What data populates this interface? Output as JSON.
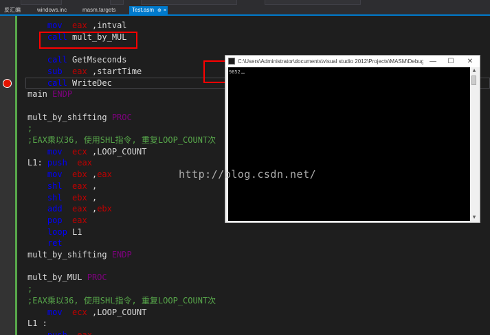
{
  "tabs": [
    {
      "label": "反汇编",
      "active": false
    },
    {
      "label": "windows.inc",
      "active": false
    },
    {
      "label": "masm.targets",
      "active": false
    },
    {
      "label": "Test.asm",
      "active": true,
      "pin_icon": "pin-icon",
      "close_icon": "close-icon"
    }
  ],
  "toolbar": {
    "label_left": "",
    "label_mid": ""
  },
  "code": [
    {
      "indent": "    ",
      "op": "mov",
      "a1": "eax",
      "sep": " ,",
      "rest": "intval"
    },
    {
      "indent": "    ",
      "op": "call",
      "rest": " mult_by_MUL"
    },
    {
      "indent": "",
      "op": "",
      "rest": ""
    },
    {
      "indent": "    ",
      "op": "call",
      "rest": " GetMseconds"
    },
    {
      "indent": "    ",
      "op": "sub",
      "a1": "eax",
      "sep": " ,",
      "rest": "startTime"
    },
    {
      "indent": "    ",
      "op": "call",
      "rest": " WriteDec"
    },
    {
      "text": "main",
      "dir": "ENDP"
    },
    {
      "text": ""
    },
    {
      "text": "mult_by_shifting",
      "dir": "PROC"
    },
    {
      "comment": ";"
    },
    {
      "comment": ";EAX乘以36, 使用SHL指令, 重复LOOP_COUNT次"
    },
    {
      "indent": "    ",
      "op": "mov",
      "a1": "ecx",
      "sep": " ,",
      "rest": "LOOP_COUNT"
    },
    {
      "label": "L1:",
      "op": "push",
      "a1": "eax"
    },
    {
      "indent": "    ",
      "op": "mov",
      "a1": "ebx",
      "sep": " ,",
      "a2": "eax"
    },
    {
      "indent": "    ",
      "op": "shl",
      "a1": "eax",
      "sep": " ,"
    },
    {
      "indent": "    ",
      "op": "shl",
      "a1": "ebx",
      "sep": " ,"
    },
    {
      "indent": "    ",
      "op": "add",
      "a1": "eax",
      "sep": " ,",
      "a2": "ebx"
    },
    {
      "indent": "    ",
      "op": "pop",
      "a1": "eax"
    },
    {
      "indent": "    ",
      "op": "loop",
      "rest": " L1"
    },
    {
      "indent": "    ",
      "op": "ret"
    },
    {
      "text": "mult_by_shifting",
      "dir": "ENDP"
    },
    {
      "text": ""
    },
    {
      "text": "mult_by_MUL",
      "dir": "PROC"
    },
    {
      "comment": ";"
    },
    {
      "comment": ";EAX乘以36, 使用SHL指令, 重复LOOP_COUNT次"
    },
    {
      "indent": "    ",
      "op": "mov",
      "a1": "ecx",
      "sep": " ,",
      "rest": "LOOP_COUNT"
    },
    {
      "text": "L1 :"
    },
    {
      "indent": "    ",
      "op": "push",
      "a1": "eax"
    }
  ],
  "console": {
    "title": "C:\\Users\\Administrator\\documents\\visual studio 2012\\Projects\\MASM\\Debug\\MASM.exe",
    "output": "9852",
    "minimize": "—",
    "maximize": "☐",
    "close": "✕"
  },
  "watermark": "http://blog.csdn.net/",
  "colors": {
    "keyword": "#0000ff",
    "register": "#c00000",
    "directive": "#800080",
    "comment": "#57a64a",
    "text": "#dcdcdc",
    "tab_active": "#007acc",
    "annotation": "#ff0000"
  }
}
